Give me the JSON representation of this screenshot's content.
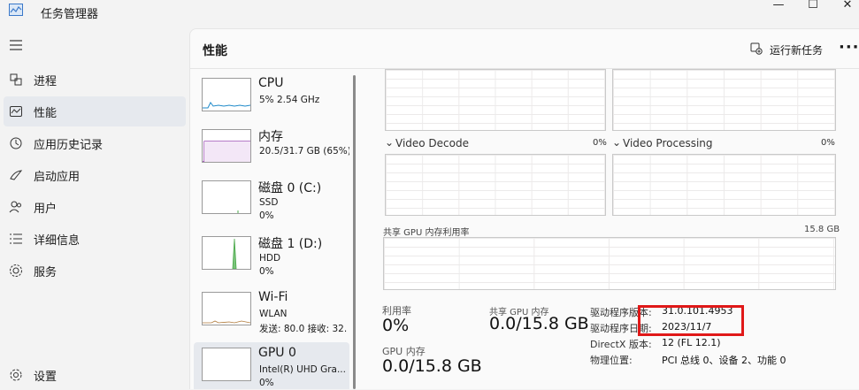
{
  "window": {
    "title": "任务管理器",
    "minimize": "—",
    "maximize": "☐",
    "close": "✕"
  },
  "nav": {
    "items": [
      {
        "label": "进程",
        "icon": "processes-icon"
      },
      {
        "label": "性能",
        "icon": "performance-icon",
        "selected": true
      },
      {
        "label": "应用历史记录",
        "icon": "app-history-icon"
      },
      {
        "label": "启动应用",
        "icon": "startup-apps-icon"
      },
      {
        "label": "用户",
        "icon": "users-icon"
      },
      {
        "label": "详细信息",
        "icon": "details-icon"
      },
      {
        "label": "服务",
        "icon": "services-icon"
      }
    ],
    "settings": {
      "label": "设置",
      "icon": "gear-icon"
    }
  },
  "header": {
    "title": "性能",
    "run_task": "运行新任务",
    "more": "···"
  },
  "devices": [
    {
      "name": "CPU",
      "line2": "5% 2.54 GHz",
      "line3": "",
      "graph_color": "#1f8ac9"
    },
    {
      "name": "内存",
      "line2": "20.5/31.7 GB (65%)",
      "line3": "",
      "graph_color": "#8b2fa8"
    },
    {
      "name": "磁盘 0 (C:)",
      "line2": "SSD",
      "line3": "0%",
      "graph_color": "#4aa84a"
    },
    {
      "name": "磁盘 1 (D:)",
      "line2": "HDD",
      "line3": "0%",
      "graph_color": "#4aa84a"
    },
    {
      "name": "Wi-Fi",
      "line2": "WLAN",
      "line3": "发送: 80.0 接收: 32.",
      "graph_color": "#b07a3a"
    },
    {
      "name": "GPU 0",
      "line2": "Intel(R) UHD Gra...",
      "line3": "0%",
      "graph_color": "#1f8ac9",
      "selected": true
    }
  ],
  "gpu": {
    "engines": [
      {
        "name": "Video Decode",
        "value": "0%"
      },
      {
        "name": "Video Processing",
        "value": "0%"
      }
    ],
    "shared_memory_chart": {
      "label": "共享 GPU 内存利用率",
      "max": "15.8 GB"
    },
    "stats": {
      "utilization": {
        "label": "利用率",
        "value": "0%"
      },
      "shared_memory": {
        "label": "共享 GPU 内存",
        "value": "0.0/15.8 GB"
      },
      "gpu_memory": {
        "label": "GPU 内存",
        "value": "0.0/15.8 GB"
      }
    },
    "info": [
      {
        "label": "驱动程序版本:",
        "value": "31.0.101.4953"
      },
      {
        "label": "驱动程序日期:",
        "value": "2023/11/7"
      },
      {
        "label": "DirectX 版本:",
        "value": "12 (FL 12.1)"
      },
      {
        "label": "物理位置:",
        "value": "PCI 总线 0、设备 2、功能 0"
      }
    ],
    "highlight_color": "#e01818"
  }
}
